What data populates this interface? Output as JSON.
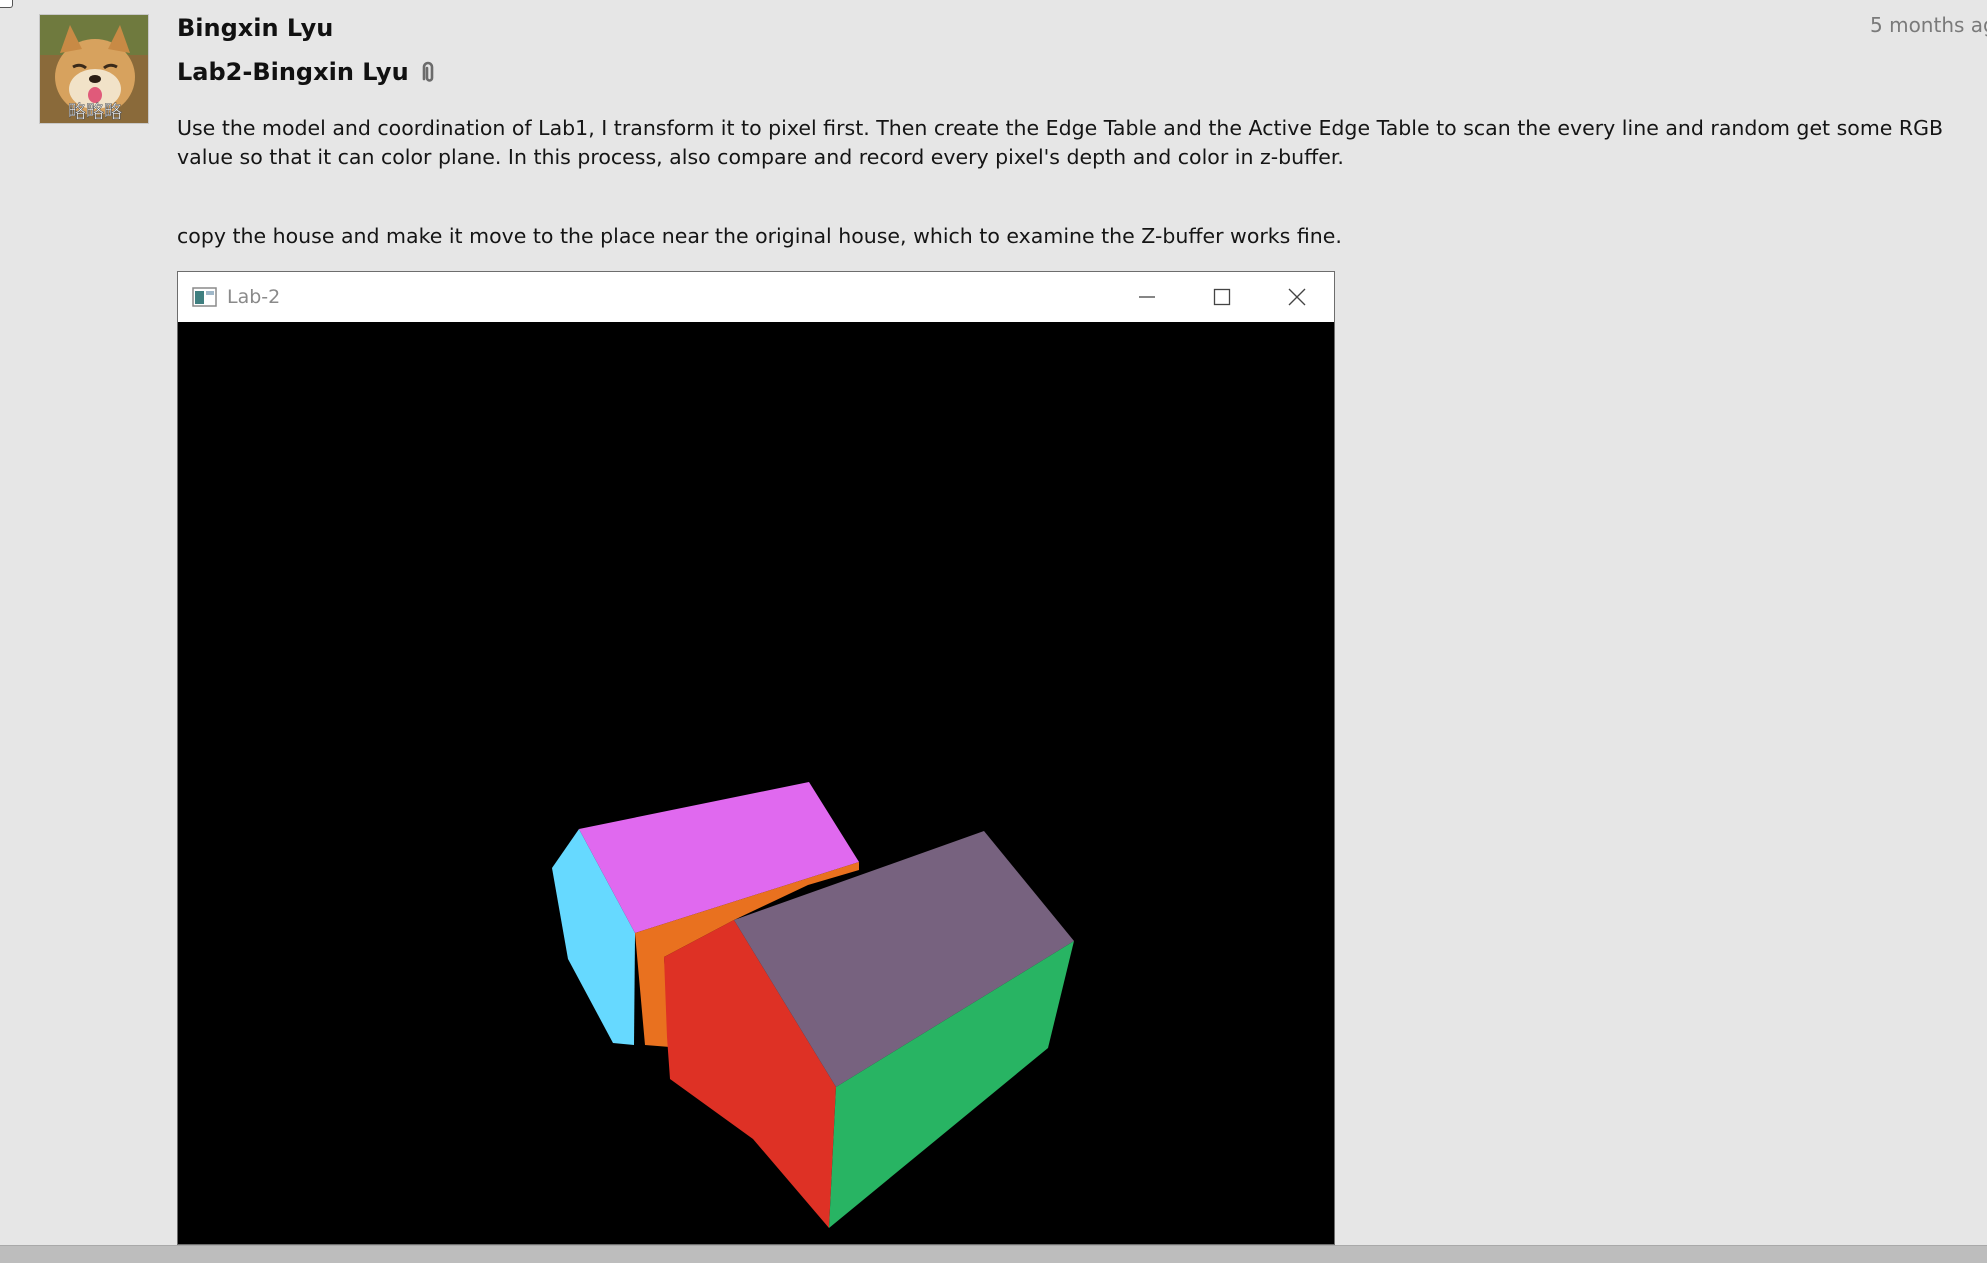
{
  "post": {
    "author": "Bingxin Lyu",
    "timestamp": "5 months ag",
    "title": "Lab2-Bingxin Lyu",
    "paragraphs": [
      "Use the model and coordination of Lab1, I transform it to pixel first. Then create the Edge Table and the Active Edge Table to scan the every line and random get some RGB value so that it can color plane. In this process, also compare and record every pixel's depth and color in z-buffer.",
      "copy the house and make it move to the place near the original house, which to examine the Z-buffer works fine."
    ],
    "avatar_caption": "略略略"
  },
  "window": {
    "title": "Lab-2",
    "controls": [
      "minimize-icon",
      "maximize-icon",
      "close-icon"
    ]
  },
  "render": {
    "background": "#000000",
    "face_colors": {
      "back_left_side": "#66d9ff",
      "back_roof": "#e069ef",
      "back_front_orange": "#e9711f",
      "front_left_red": "#de3125",
      "front_roof": "#77627f",
      "front_right_green": "#28b463"
    }
  }
}
